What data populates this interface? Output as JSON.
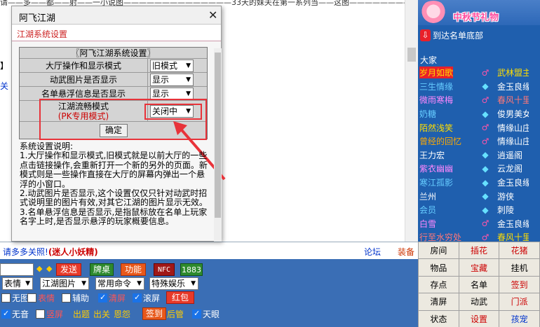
{
  "background": {
    "top_strip": "请——多——都——射——一小说图——————————————33天的妹夫在第一系列当——这图————————",
    "frag1": "】",
    "frag2": "关",
    "frag2_text": "关E"
  },
  "sidebar": {
    "banner": "中秋节礼物",
    "to_bottom": "到达名单底部",
    "room": "大家",
    "users": [
      {
        "name": "岁月如歌",
        "color": "#ffdd00",
        "bg": "#e8202a",
        "icon": "♂",
        "icon_color": "#ff55aa",
        "faction": "武林盟主",
        "faction_color": "#ffdd00"
      },
      {
        "name": "三生情缘",
        "color": "#66ccff",
        "bg": "",
        "icon": "◆",
        "icon_color": "#66e0ff",
        "faction": "金玉良缘",
        "faction_color": "#ffffff"
      },
      {
        "name": "微雨寒梅",
        "color": "#ff88ff",
        "bg": "",
        "icon": "♂",
        "icon_color": "#ff55aa",
        "faction": "春风十里",
        "faction_color": "#ff7777"
      },
      {
        "name": "奶糖",
        "color": "#66ccff",
        "bg": "",
        "icon": "◆",
        "icon_color": "#66e0ff",
        "faction": "俊男美女坊",
        "faction_color": "#ffffff"
      },
      {
        "name": "陌然浅笑",
        "color": "#ffdd00",
        "bg": "",
        "icon": "♂",
        "icon_color": "#ff55aa",
        "faction": "情缘山庄",
        "faction_color": "#ffffff"
      },
      {
        "name": "曾经的回忆",
        "color": "#ffaa00",
        "bg": "",
        "icon": "♂",
        "icon_color": "#ff55aa",
        "faction": "情缘山庄",
        "faction_color": "#ffffff"
      },
      {
        "name": "王力宏",
        "color": "#ffffff",
        "bg": "",
        "icon": "◆",
        "icon_color": "#66e0ff",
        "faction": "逍遥阁",
        "faction_color": "#ffffff"
      },
      {
        "name": "紫衣幽幽",
        "color": "#ff88ff",
        "bg": "",
        "icon": "◆",
        "icon_color": "#66e0ff",
        "faction": "云龙阁",
        "faction_color": "#ffffff"
      },
      {
        "name": "寒江孤影",
        "color": "#66ccff",
        "bg": "",
        "icon": "◆",
        "icon_color": "#66e0ff",
        "faction": "金玉良缘",
        "faction_color": "#ffffff"
      },
      {
        "name": "兰州",
        "color": "#ffffff",
        "bg": "",
        "icon": "◆",
        "icon_color": "#66e0ff",
        "faction": "游侠",
        "faction_color": "#ffffff"
      },
      {
        "name": "会员",
        "color": "#66ccff",
        "bg": "",
        "icon": "◆",
        "icon_color": "#66e0ff",
        "faction": "刺陵",
        "faction_color": "#ffffff"
      },
      {
        "name": "白雪",
        "color": "#ff88ff",
        "bg": "",
        "icon": "♂",
        "icon_color": "#ff55aa",
        "faction": "金玉良缘",
        "faction_color": "#ffffff"
      },
      {
        "name": "行至水穷处",
        "color": "#ff7777",
        "bg": "",
        "icon": "♂",
        "icon_color": "#ff55aa",
        "faction": "春风十里",
        "faction_color": "#ffdd00"
      }
    ]
  },
  "chat_line": {
    "notice_prefix": "请多多关照!",
    "notice_highlight": "(迷人小妖精)",
    "forum": "论坛",
    "equip": "装备"
  },
  "controls": {
    "send": "发送",
    "card_table": "牌桌",
    "functions": "功能",
    "nfc": "NFC",
    "num": "1883",
    "arrow_left": "◆",
    "arrow_right": "◆",
    "selects": [
      "表情",
      "江湖图片",
      "常用命令",
      "特殊娱乐"
    ],
    "row3": [
      {
        "label": "无图",
        "checked": false
      },
      {
        "label": "表情",
        "checked": false
      },
      {
        "label": "辅助",
        "checked": false
      },
      {
        "label": "清屏",
        "checked": true
      },
      {
        "label": "滚屏",
        "checked": true
      }
    ],
    "red_pack": "红包",
    "row4": [
      {
        "label": "无音",
        "checked": true
      },
      {
        "label": "竖屏",
        "checked": false
      }
    ],
    "row4_links": [
      "出题",
      "出关",
      "恩怨"
    ],
    "sign_in": "签到",
    "kitchen": "后管",
    "heaven_eye": {
      "label": "天眼",
      "checked": true
    }
  },
  "grid": [
    [
      {
        "t": "房间",
        "c": "#000"
      },
      {
        "t": "插花",
        "c": "#cc0000"
      },
      {
        "t": "花猪",
        "c": "#cc0000"
      }
    ],
    [
      {
        "t": "物品",
        "c": "#000"
      },
      {
        "t": "宝藏",
        "c": "#cc0000"
      },
      {
        "t": "挂机",
        "c": "#000"
      }
    ],
    [
      {
        "t": "存点",
        "c": "#000"
      },
      {
        "t": "名单",
        "c": "#000"
      },
      {
        "t": "签到",
        "c": "#cc0000"
      }
    ],
    [
      {
        "t": "清屏",
        "c": "#000"
      },
      {
        "t": "动武",
        "c": "#000"
      },
      {
        "t": "门派",
        "c": "#cc0000"
      }
    ],
    [
      {
        "t": "状态",
        "c": "#000"
      },
      {
        "t": "设置",
        "c": "#cc0000"
      },
      {
        "t": "孩宠",
        "c": "#0033cc"
      }
    ]
  ],
  "dialog": {
    "title": "阿飞江湖",
    "close": "✕",
    "subtitle": "江湖系统设置",
    "table_header": "〖阿飞江湖系统设置〗",
    "rows": [
      {
        "label": "大厅操作和显示模式",
        "value": "旧模式"
      },
      {
        "label": "动武图片是否显示",
        "value": "显示"
      },
      {
        "label": "名单悬浮信息是否显示",
        "value": "显示"
      }
    ],
    "flow_label": "江湖流畅模式",
    "flow_sub": "(PK专用模式)",
    "flow_value": "关闭中",
    "ok": "确定",
    "desc_lines": [
      "系统设置说明:",
      "1.大厅操作和显示模式,旧模式就是以前大厅的一些点击链接操作,会重新打开一个新的另外的页面。新模式则是一些操作直接在大厅的屏幕内弹出一个悬浮的小窗口。",
      "2.动武图片是否显示,这个设置仅仅只针对动武时招式说明里的图片有效,对其它江湖的图片显示无效。",
      "3.名单悬浮信息是否显示,是指鼠标放在名单上玩家名字上时,是否显示悬浮的玩家概要信息。"
    ]
  }
}
